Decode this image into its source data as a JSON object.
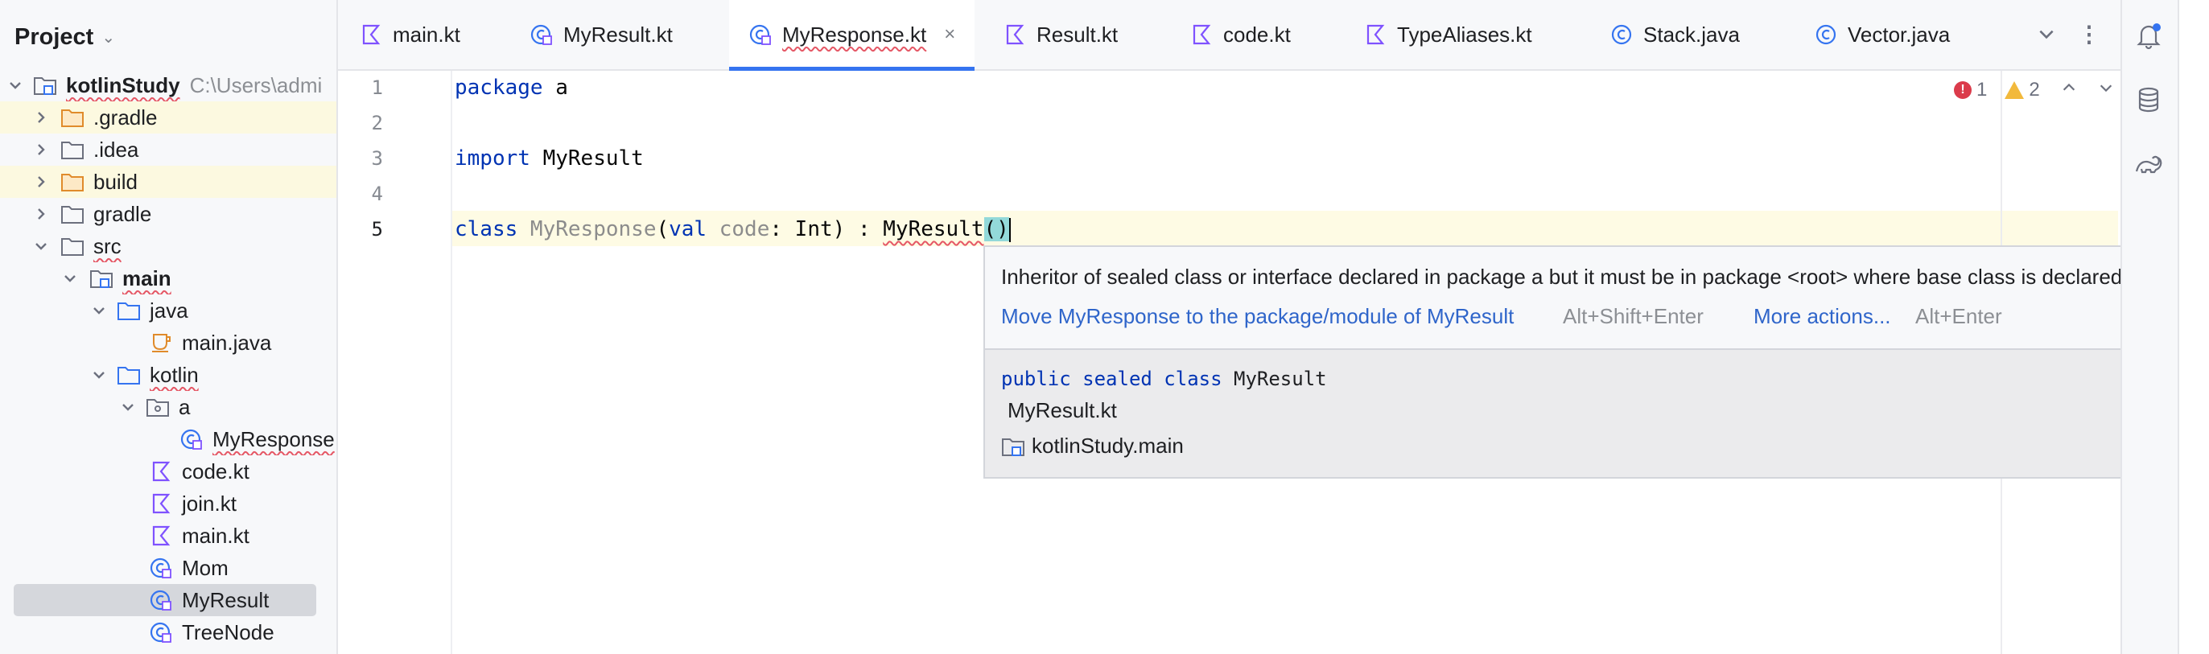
{
  "project_panel": {
    "title": "Project",
    "tree": [
      {
        "label": "kotlinStudy",
        "path": "C:\\Users\\admi",
        "icon": "module-folder-icon"
      },
      {
        "label": ".gradle",
        "icon": "excluded-folder-icon"
      },
      {
        "label": ".idea",
        "icon": "folder-icon"
      },
      {
        "label": "build",
        "icon": "excluded-folder-icon"
      },
      {
        "label": "gradle",
        "icon": "folder-icon"
      },
      {
        "label": "src",
        "icon": "folder-icon"
      },
      {
        "label": "main",
        "icon": "module-folder-icon"
      },
      {
        "label": "java",
        "icon": "source-folder-icon"
      },
      {
        "label": "main.java",
        "icon": "java-file-icon"
      },
      {
        "label": "kotlin",
        "icon": "source-folder-icon"
      },
      {
        "label": "a",
        "icon": "package-icon"
      },
      {
        "label": "MyResponse",
        "icon": "kotlin-class-icon"
      },
      {
        "label": "code.kt",
        "icon": "kotlin-file-icon"
      },
      {
        "label": "join.kt",
        "icon": "kotlin-file-icon"
      },
      {
        "label": "main.kt",
        "icon": "kotlin-file-icon"
      },
      {
        "label": "Mom",
        "icon": "kotlin-class-icon"
      },
      {
        "label": "MyResult",
        "icon": "kotlin-class-icon"
      },
      {
        "label": "TreeNode",
        "icon": "kotlin-class-icon"
      }
    ]
  },
  "tabs": [
    {
      "label": "main.kt",
      "icon": "kotlin-file-icon"
    },
    {
      "label": "MyResult.kt",
      "icon": "kotlin-class-icon"
    },
    {
      "label": "MyResponse.kt",
      "icon": "kotlin-class-icon",
      "active": true
    },
    {
      "label": "Result.kt",
      "icon": "kotlin-file-icon"
    },
    {
      "label": "code.kt",
      "icon": "kotlin-file-icon"
    },
    {
      "label": "TypeAliases.kt",
      "icon": "kotlin-file-icon"
    },
    {
      "label": "Stack.java",
      "icon": "java-class-icon"
    },
    {
      "label": "Vector.java",
      "icon": "java-class-icon"
    }
  ],
  "tab_close": "×",
  "editor": {
    "line_numbers": [
      "1",
      "2",
      "3",
      "4",
      "5"
    ],
    "line1": {
      "kw": "package",
      "rest": " a"
    },
    "line3": {
      "kw": "import",
      "rest": " MyResult"
    },
    "line5": {
      "kw_class": "class",
      "name": " MyResponse",
      "open": "(",
      "kw_val": "val",
      "param": " code",
      "type": ": Int) : ",
      "super": "MyResult",
      "call": "()"
    },
    "inspection": {
      "errors": "1",
      "warnings": "2"
    }
  },
  "popup": {
    "message": "Inheritor of sealed class or interface declared in package a but it must be in package <root> where base class is declared",
    "fix_label": "Move MyResponse to the package/module of MyResult",
    "fix_shortcut": "Alt+Shift+Enter",
    "more_label": "More actions...",
    "more_shortcut": "Alt+Enter",
    "doc_kw": "public sealed class",
    "doc_name": " MyResult",
    "doc_file": "MyResult.kt",
    "doc_module": "kotlinStudy.main"
  },
  "colors": {
    "accent": "#3574f0",
    "keyword": "#0033b3",
    "link": "#2f65ca",
    "error": "#db3b4b",
    "warning": "#f2b93c",
    "selection": "#d5d7dc",
    "excluded_highlight": "#fcf9e0"
  },
  "tool_strip": [
    "notifications-icon",
    "database-icon",
    "gradle-icon"
  ]
}
